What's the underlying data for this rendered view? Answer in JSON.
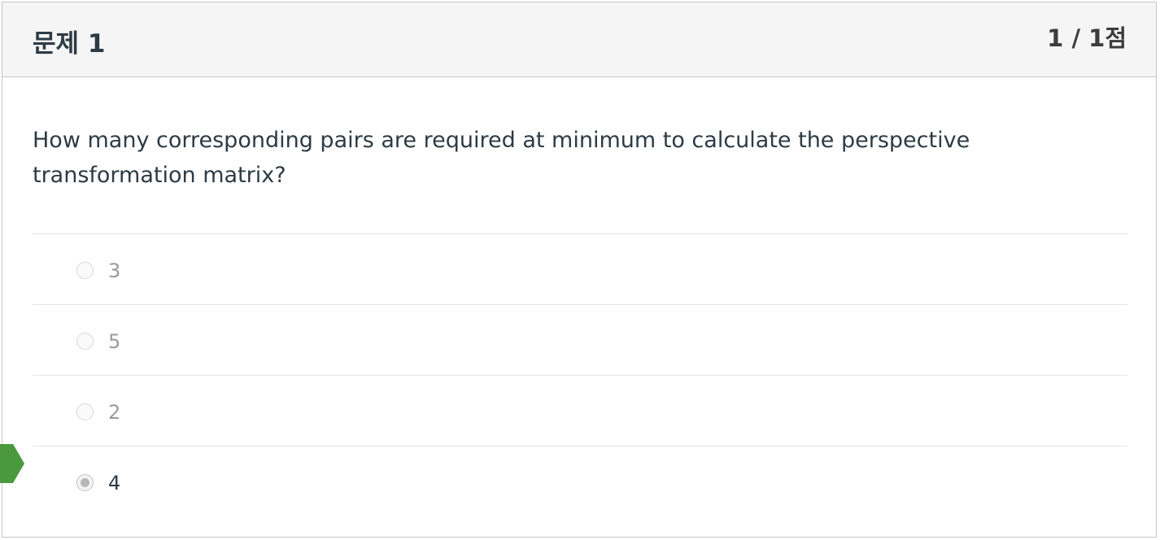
{
  "question": {
    "title": "문제 1",
    "points": "1 / 1점",
    "text": "How many corresponding pairs are required at minimum to calculate the perspective transformation matrix?"
  },
  "answers": [
    {
      "label": "3",
      "selected": false
    },
    {
      "label": "5",
      "selected": false
    },
    {
      "label": "2",
      "selected": false
    },
    {
      "label": "4",
      "selected": true
    }
  ],
  "colors": {
    "correct_marker": "#4a9a3d",
    "text_primary": "#2d3b45",
    "text_muted": "#9a9a9a",
    "header_bg": "#f5f5f5"
  },
  "icons": {
    "correct_marker": "correct-answer-arrow-icon"
  }
}
